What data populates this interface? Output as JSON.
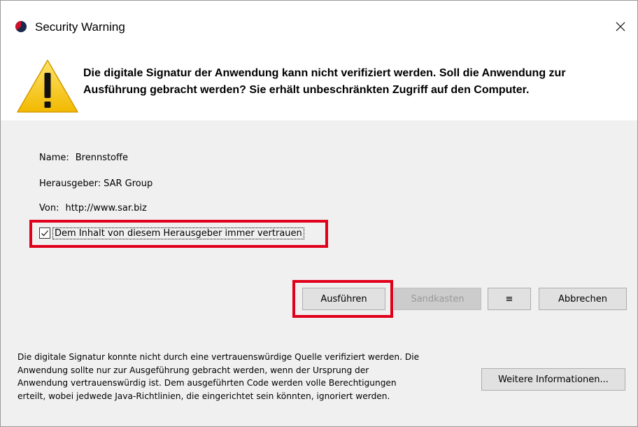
{
  "window": {
    "title": "Security Warning",
    "close_glyph": "×"
  },
  "header": {
    "icon": "warning-triangle-icon",
    "message_lines": [
      "Die digitale Signatur der Anwendung kann nicht verifiziert werden. Soll die Anwendung zur",
      "Ausführung gebracht werden? Sie erhält unbeschränkten Zugriff auf den Computer."
    ]
  },
  "info": {
    "name_label": "Name:",
    "name_value": "Brennstoffe",
    "publisher_label": "Herausgeber:",
    "publisher_value": "SAR Group",
    "from_label": "Von:",
    "from_value": "http://www.sar.biz"
  },
  "trust": {
    "checked": true,
    "label": "Dem Inhalt von diesem Herausgeber immer vertrauen"
  },
  "buttons": {
    "run": "Ausführen",
    "sandbox": "Sandkasten",
    "menu": "≡",
    "cancel": "Abbrechen",
    "more_info": "Weitere Informationen..."
  },
  "footer": {
    "lines": [
      "Die digitale Signatur konnte nicht durch eine vertrauenswürdige Quelle verifiziert werden. Die",
      "Anwendung sollte nur zur Ausgeführung gebracht werden, wenn der Ursprung der",
      "Anwendung vertrauenswürdig ist. Dem ausgeführten Code werden volle Berechtigungen",
      "erteilt, wobei jedwede Java-Richtlinien, die eingerichtet sein könnten, ignoriert werden."
    ]
  },
  "colors": {
    "highlight": "#e0001b",
    "warning_yellow": "#f6c400",
    "dialog_bg": "#f0f0f0"
  }
}
